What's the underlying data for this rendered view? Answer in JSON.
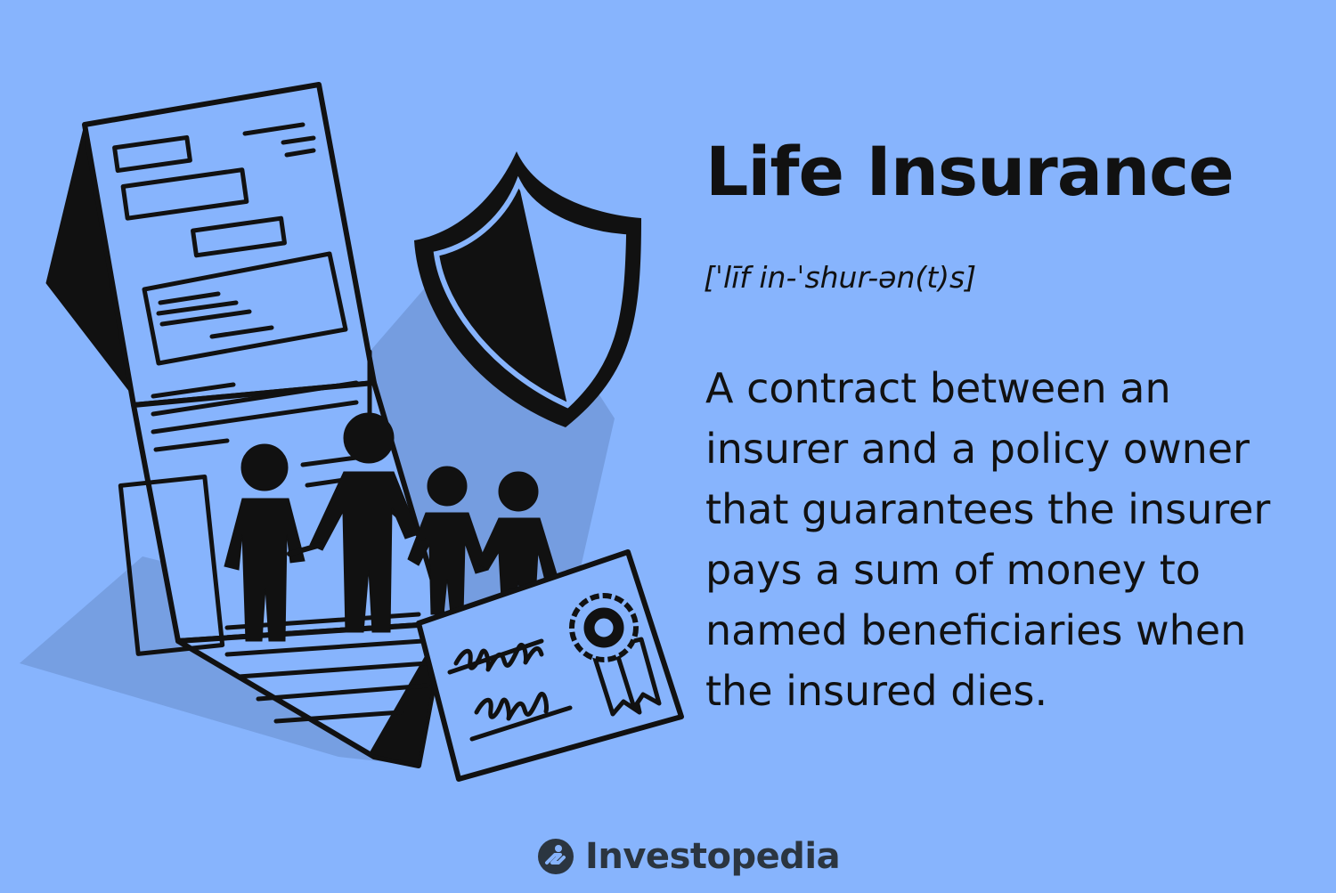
{
  "term": "Life Insurance",
  "pronunciation": "[ˈlīf in-ˈshur-ən(t)s]",
  "definition": "A contract between an insurer and a policy owner that guarantees the insurer pays a sum of money to named beneficiaries when the insured dies.",
  "brand": {
    "name": "Investopedia",
    "icon": "investopedia-logo-icon"
  },
  "illustration": {
    "icons": [
      "policy-document-icon",
      "shield-icon",
      "family-icon",
      "certificate-icon",
      "award-ribbon-icon"
    ]
  },
  "colors": {
    "background": "#87b4fd",
    "ink": "#111111",
    "shadow": "#6f95d6",
    "brand_text": "#2b3540"
  }
}
